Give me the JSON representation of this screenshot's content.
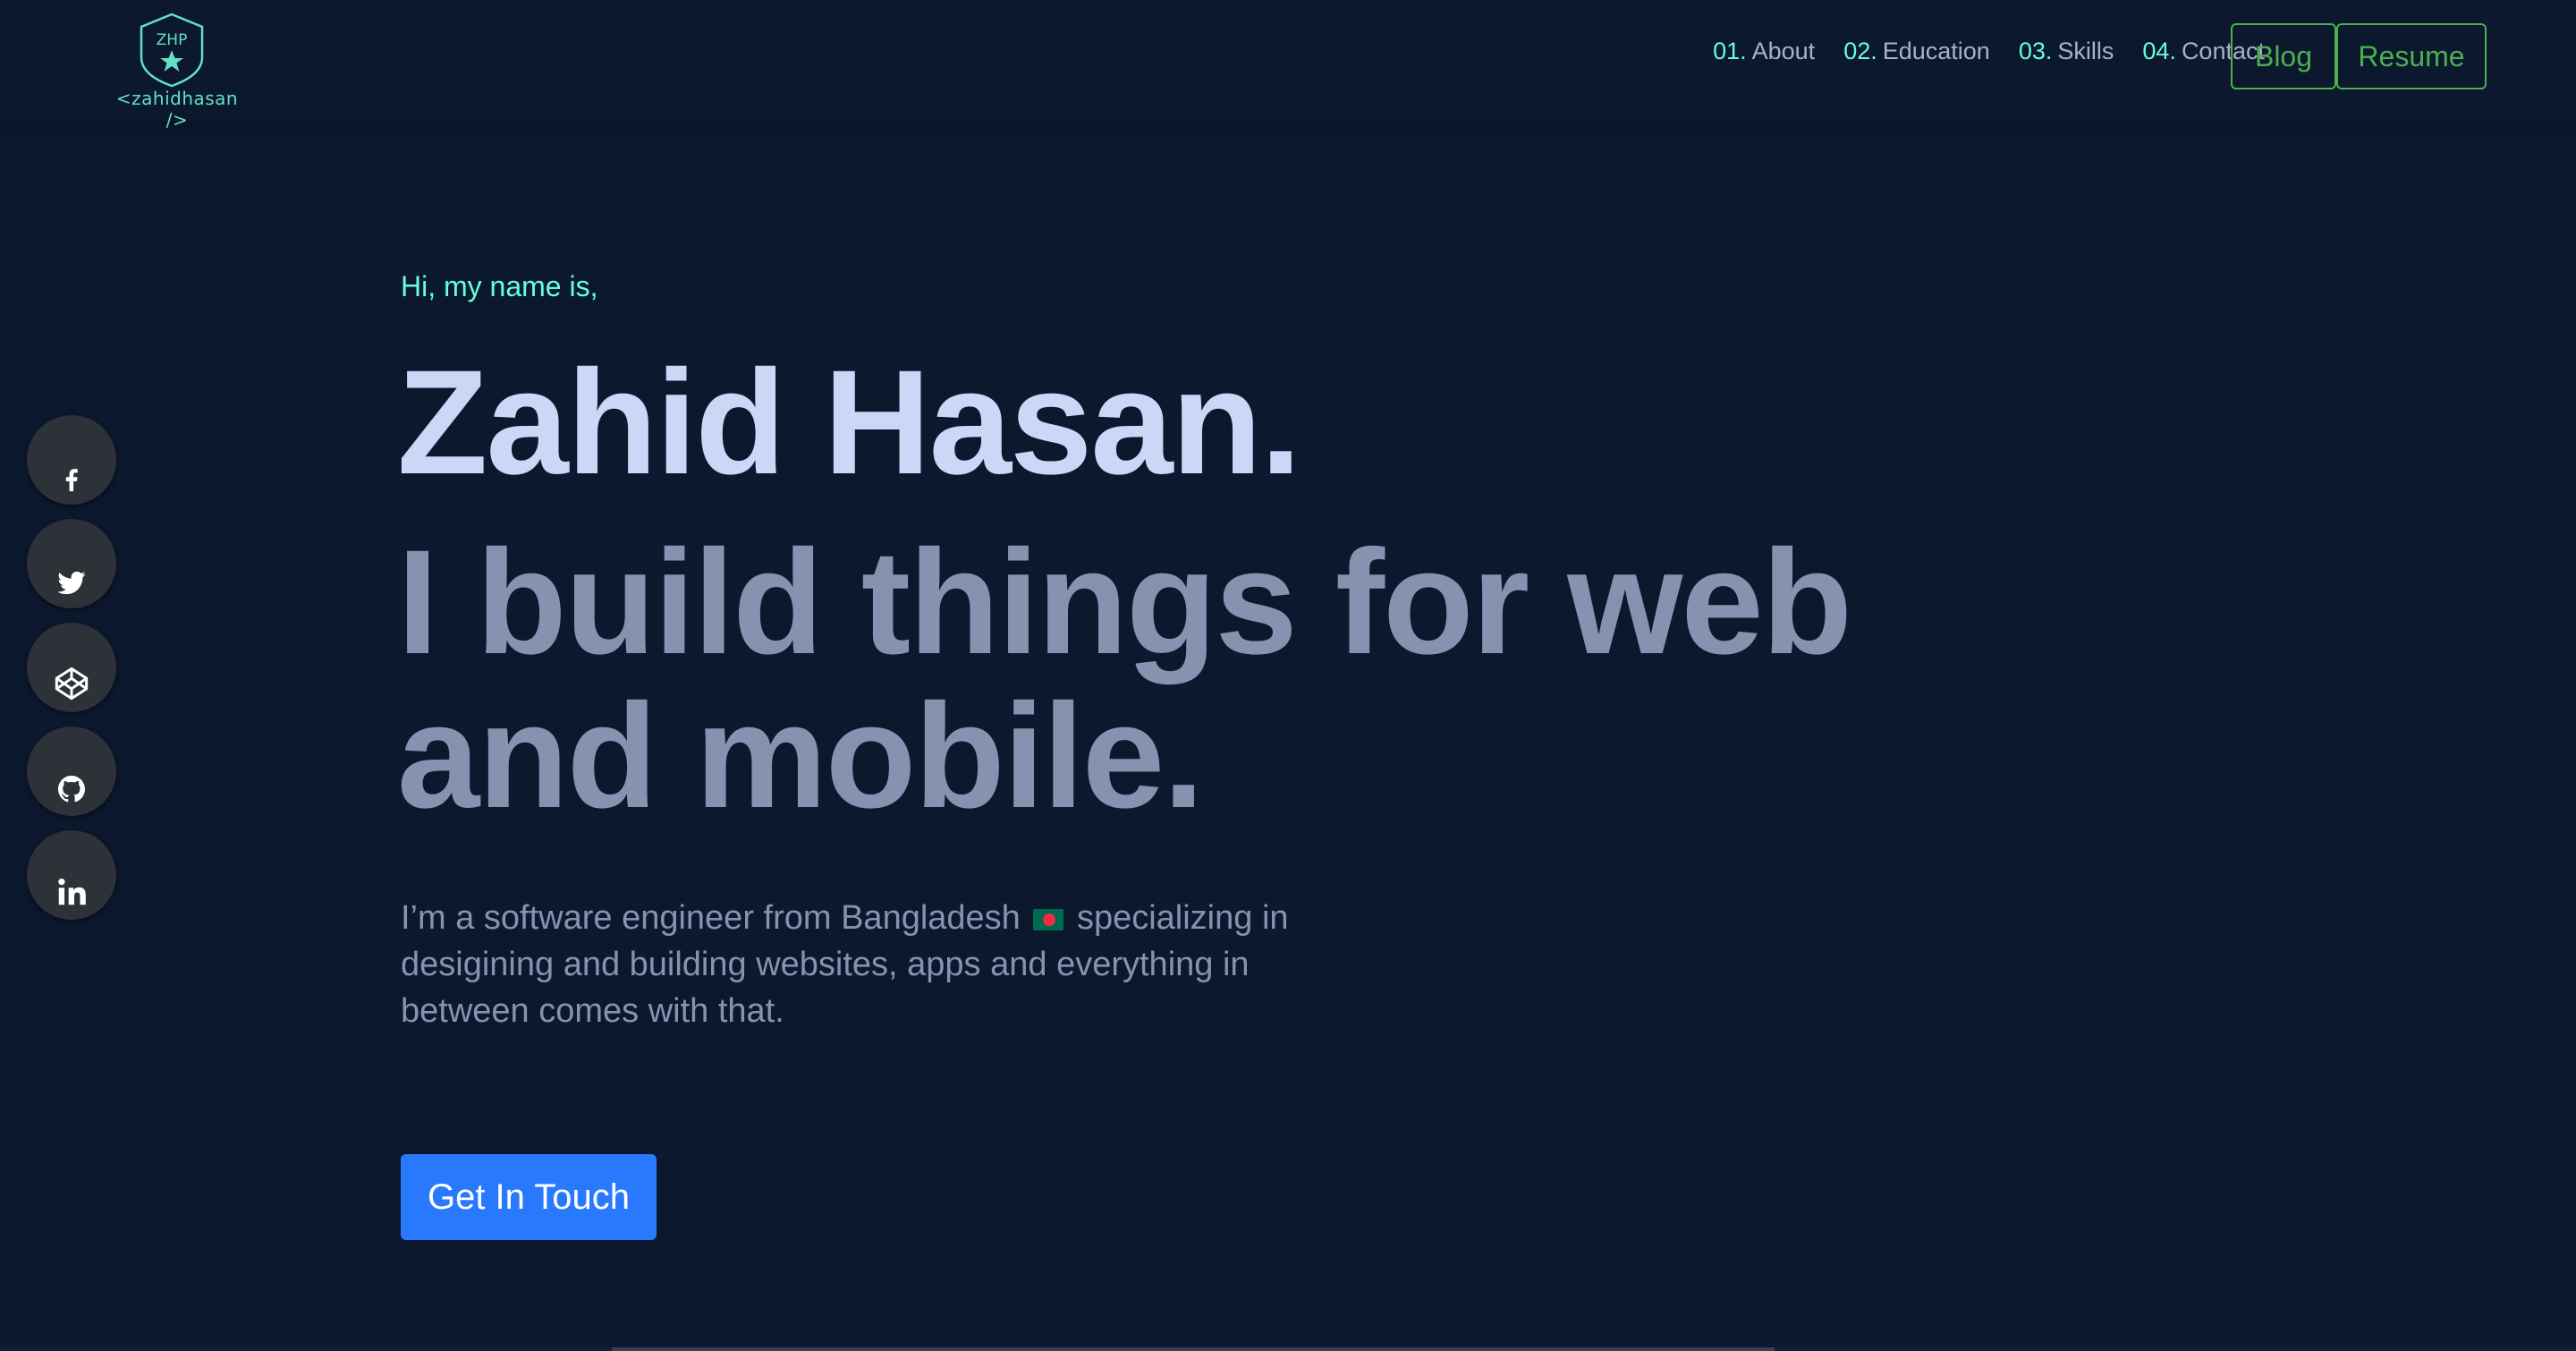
{
  "logo": {
    "initials": "ZHP",
    "text": "<zahidhasan />"
  },
  "nav": {
    "items": [
      {
        "num": "01.",
        "label": "About"
      },
      {
        "num": "02.",
        "label": "Education"
      },
      {
        "num": "03.",
        "label": "Skills"
      },
      {
        "num": "04.",
        "label": "Contact"
      }
    ],
    "blog_label": "Blog",
    "resume_label": "Resume"
  },
  "social": [
    {
      "icon": "facebook-icon"
    },
    {
      "icon": "twitter-icon"
    },
    {
      "icon": "codepen-icon"
    },
    {
      "icon": "github-icon"
    },
    {
      "icon": "linkedin-icon"
    }
  ],
  "hero": {
    "intro": "Hi, my name is,",
    "name": "Zahid Hasan.",
    "tagline": "I build things for web and mobile.",
    "desc_part1": "I’m a software engineer from Bangladesh",
    "desc_part2": "specializing in desigining and building websites, apps and everything in between comes with that.",
    "cta_label": "Get In Touch"
  },
  "colors": {
    "background": "#0c182e",
    "accent": "#64ffda",
    "heading": "#ccd6f6",
    "body_text": "#8892b0",
    "outline_button": "#4caf50",
    "cta": "#2979ff"
  }
}
